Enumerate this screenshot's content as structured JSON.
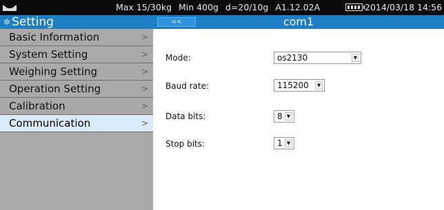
{
  "status_bar": {
    "max": "Max 15/30kg",
    "min": "Min 400g",
    "division": "d=20/10g",
    "version": "A1.12.02A",
    "date_time": "2014/03/18  14:56"
  },
  "sidebar": {
    "title": "Setting",
    "items": [
      {
        "label": "Basic Information"
      },
      {
        "label": "System Setting"
      },
      {
        "label": "Weighing Setting"
      },
      {
        "label": "Operation Setting"
      },
      {
        "label": "Calibration"
      },
      {
        "label": "Communication",
        "selected": true
      }
    ]
  },
  "header": {
    "back_label": "<<",
    "title": "com1"
  },
  "form": {
    "mode": {
      "label": "Mode:",
      "value": "os2130"
    },
    "baud_rate": {
      "label": "Baud rate:",
      "value": "115200"
    },
    "data_bits": {
      "label": "Data bits:",
      "value": "8"
    },
    "stop_bits": {
      "label": "Stop bits:",
      "value": "1"
    }
  },
  "colors": {
    "header_blue": "#1c7fc6",
    "sidebar_gray": "#a9a9a9",
    "selected_item": "#d9ebf9",
    "status_bar": "#0b0b0b"
  }
}
